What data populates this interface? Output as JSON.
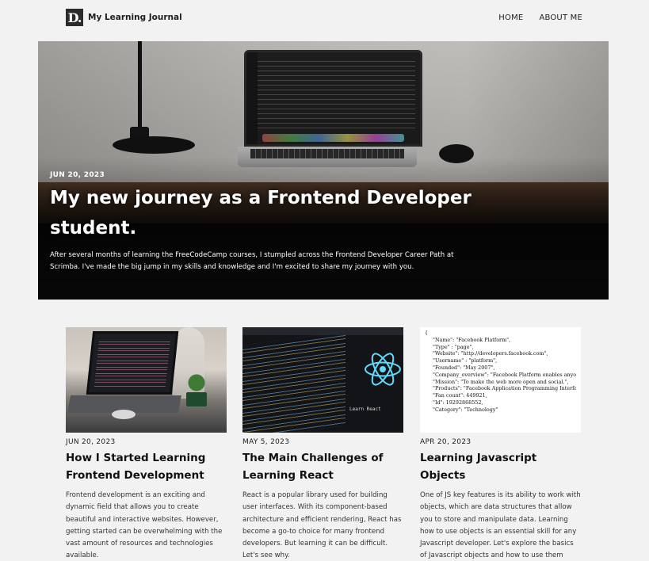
{
  "header": {
    "logo_mark": "D.",
    "site_title": "My Learning Journal",
    "nav": [
      {
        "label": "HOME"
      },
      {
        "label": "ABOUT ME"
      }
    ]
  },
  "hero": {
    "date": "JUN 20, 2023",
    "title": "My new journey as a Frontend Developer student.",
    "description": "After several months of learning the FreeCodeCamp courses, I stumpled across the Frontend Developer Career Path at Scrimba. I've made the big jump in my skills and knowledge and I'm excited to share my journey with you."
  },
  "posts": [
    {
      "date": "JUN 20, 2023",
      "title": "How I Started Learning Frontend Development",
      "description": "Frontend development is an exciting and dynamic field that allows you to create beautiful and interactive websites. However, getting started can be overwhelming with the vast amount of resources and technologies available."
    },
    {
      "date": "MAY 5, 2023",
      "title": "The Main Challenges of Learning React",
      "description": "React is a popular library used for building user interfaces. With its component-based architecture and efficient rendering, React has become a go-to choice for many frontend developers. But learning it can be difficult. Let's see why.",
      "image_caption": "Learn React"
    },
    {
      "date": "APR 20, 2023",
      "title": "Learning Javascript Objects",
      "description": "One of JS key features is its ability to work with objects, which are data structures that allow you to store and manipulate data. Learning how to use objects is an essential skill for any Javascript developer. Let's explore the basics of Javascript objects and how to use them effectively.",
      "image_lines": [
        "{",
        "\"Name\": \"Facebook Platform\",",
        "\"Type\" : \"page\",",
        "\"Website\": \"http://developers.facebook.com\",",
        "\"Username\" : \"platform\",",
        "\"Founded\": \"May 2007\",",
        "\"Company_overview\": \"Facebook Platform enables anyone to build...\",",
        "\"Mission\": \"To make the web more open and social.\",",
        "\"Products\": \"Facebook Application Programming Interface (API)...\",",
        "\"Fan count\": 449921,",
        "\"Id\": 19292868552,",
        "\"Category\": \"Technology\""
      ]
    }
  ],
  "colors": {
    "page_background": "#f2f2f2",
    "logo_background": "#2b2b2b",
    "hero_text": "#ffffff",
    "react_logo": "#61dafb"
  }
}
